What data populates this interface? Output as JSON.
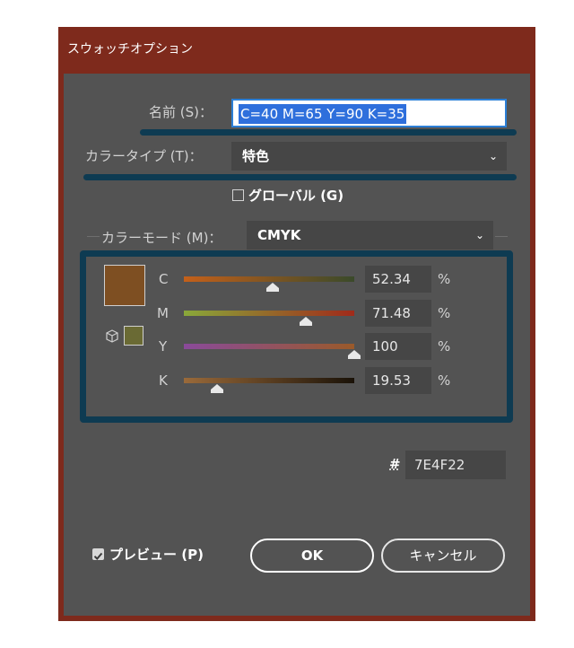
{
  "window": {
    "title": "スウォッチオプション"
  },
  "name_field": {
    "label": "名前 (S)：",
    "value": "C=40 M=65 Y=90 K=35"
  },
  "color_type": {
    "label": "カラータイプ (T)：",
    "value": "特色"
  },
  "global": {
    "label": "グローバル (G)",
    "checked": false
  },
  "color_mode": {
    "label": "カラーモード (M)：",
    "value": "CMYK"
  },
  "channels": [
    {
      "label": "C",
      "value": "52.34",
      "unit": "%",
      "fraction": 0.5234
    },
    {
      "label": "M",
      "value": "71.48",
      "unit": "%",
      "fraction": 0.7148
    },
    {
      "label": "Y",
      "value": "100",
      "unit": "%",
      "fraction": 1.0
    },
    {
      "label": "K",
      "value": "19.53",
      "unit": "%",
      "fraction": 0.1953
    }
  ],
  "hex": {
    "symbol": "#",
    "value": "7E4F22"
  },
  "preview": {
    "label": "プレビュー (P)",
    "checked": true
  },
  "buttons": {
    "ok": "OK",
    "cancel": "キャンセル"
  },
  "colors": {
    "swatch": "#7e4f22",
    "gamut_swatch": "#6a6a34",
    "panel_border": "#0e3b52",
    "dialog_bg": "#535353",
    "frame": "#7e2a1c"
  },
  "icons": {
    "gamut": "cube-icon",
    "chevron": "chevron-down-icon",
    "hex": "hash-icon"
  }
}
